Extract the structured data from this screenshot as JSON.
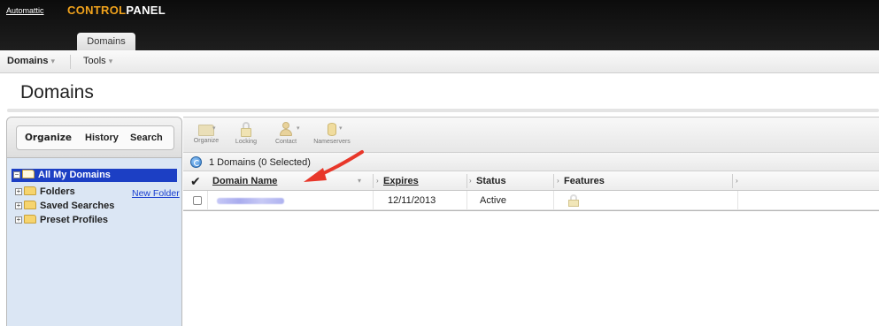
{
  "topbar": {
    "brand_link": "Automattic",
    "logo_control": "CONTROL",
    "logo_panel": "PANEL",
    "tab": "Domains"
  },
  "menubar": {
    "domains": "Domains",
    "tools": "Tools"
  },
  "page_title": "Domains",
  "left_panel": {
    "tabs": [
      "Organize",
      "History",
      "Search"
    ],
    "tree": {
      "root": "All My Domains",
      "items": [
        "Folders",
        "Saved Searches",
        "Preset Profiles"
      ],
      "new_folder": "New Folder"
    }
  },
  "toolbar": {
    "buttons": [
      "Organize",
      "Locking",
      "Contact",
      "Nameservers"
    ]
  },
  "status_text": "1 Domains (0 Selected)",
  "grid": {
    "columns": [
      "Domain Name",
      "Expires",
      "Status",
      "Features"
    ],
    "rows": [
      {
        "domain": "",
        "expires": "12/11/2013",
        "status": "Active"
      }
    ]
  },
  "colors": {
    "accent_orange": "#f0a21c",
    "tree_selection": "#1c3fc4",
    "tree_background": "#dbe6f4",
    "annotation_arrow": "#e8372a"
  }
}
